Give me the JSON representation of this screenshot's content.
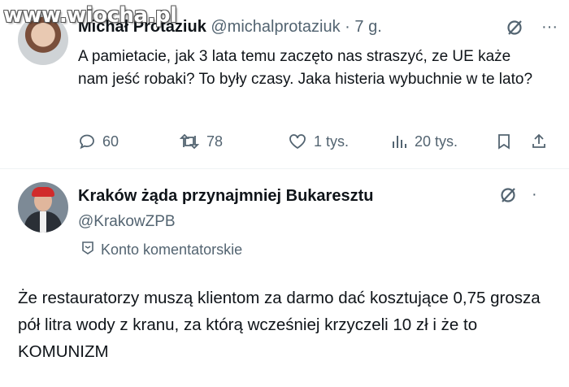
{
  "watermark": "www.wiocha.pl",
  "tweet1": {
    "author_name": "Michał Protaziuk",
    "handle_time": "@michalprotaziuk · 7 g.",
    "text": "A pamietacie, jak 3 lata temu zaczęto nas straszyć, ze UE każe nam jeść robaki? To były czasy. Jaka histeria wybuchnie w te lato?",
    "more_glyph": "···",
    "replies": "60",
    "retweets": "78",
    "likes": "1 tys.",
    "views": "20 tys."
  },
  "tweet2": {
    "author_name": "Kraków żąda przynajmniej Bukaresztu",
    "handle": "@KrakowZPB",
    "badge_label": "Konto komentatorskie",
    "more_glyph": "·",
    "text": "Że restauratorzy muszą klientom za darmo dać kosztujące 0,75 grosza pół litra wody z kranu, za którą wcześniej krzyczeli 10 zł i że to KOMUNIZM"
  },
  "colors": {
    "muted": "#536471",
    "text": "#0f1419",
    "divider": "#eff3f4"
  }
}
